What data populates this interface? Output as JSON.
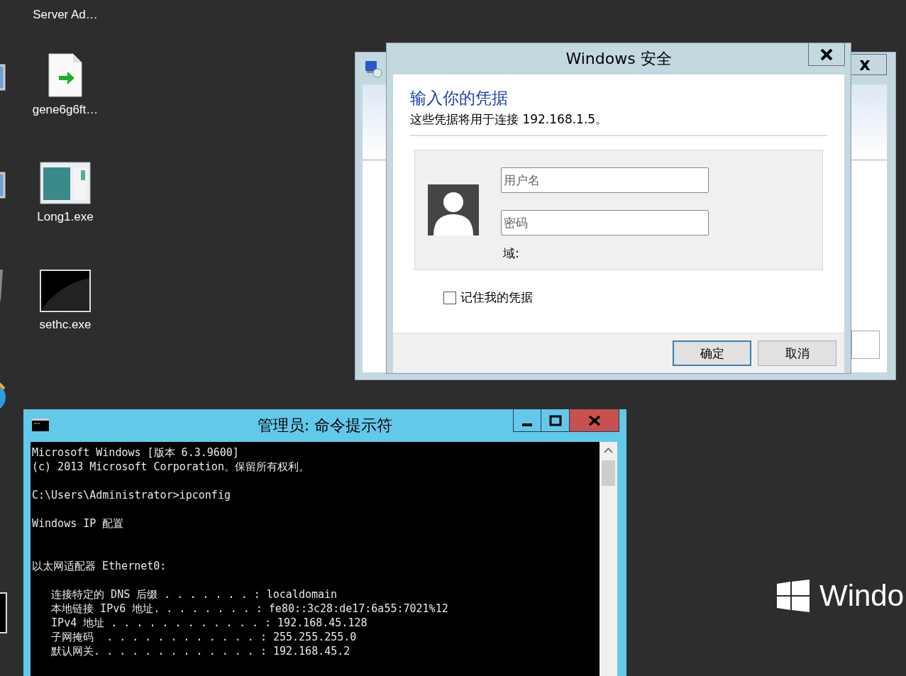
{
  "top_label": {
    "label": "Server Ad…"
  },
  "desktop_icons": [
    {
      "label": "gene6g6ft…",
      "kind": "document"
    },
    {
      "label": "Long1.exe",
      "kind": "app"
    },
    {
      "label": "sethc.exe",
      "kind": "console"
    }
  ],
  "background_window": {
    "close": "x"
  },
  "dialog": {
    "title": "Windows 安全",
    "heading": "输入你的凭据",
    "subtitle": "这些凭据将用于连接 192.168.1.5。",
    "username": {
      "placeholder": "用户名"
    },
    "password": {
      "placeholder": "密码"
    },
    "domain_label": "域:",
    "remember": {
      "label": "记住我的凭据",
      "checked": false
    },
    "buttons": [
      {
        "label": "确定",
        "selected": true
      },
      {
        "label": "取消",
        "selected": false
      }
    ]
  },
  "console": {
    "title": "管理员: 命令提示符",
    "lines": [
      {
        "text": "Microsoft Windows [版本 6.3.9600]",
        "kind": "plain"
      },
      {
        "text": "(c) 2013 Microsoft Corporation。保留所有权利。",
        "kind": "plain"
      },
      {
        "text": "C:\\Users\\Administrator>ipconfig",
        "kind": "after_blank"
      },
      {
        "text": "Windows IP 配置",
        "kind": "after_blank"
      },
      {
        "text": "以太网适配器 Ethernet0:",
        "kind": "after_two_blanks"
      },
      {
        "text": "   连接特定的 DNS 后缀 . . . . . . . : localdomain",
        "kind": "after_blank"
      },
      {
        "text": "   本地链接 IPv6 地址. . . . . . . . : fe80::3c28:de17:6a55:7021%12",
        "kind": "plain"
      },
      {
        "text": "   IPv4 地址 . . . . . . . . . . . . : 192.168.45.128",
        "kind": "plain"
      },
      {
        "text": "   子网掩码  . . . . . . . . . . . . : 255.255.255.0",
        "kind": "plain"
      },
      {
        "text": "   默认网关. . . . . . . . . . . . . : 192.168.45.2",
        "kind": "plain"
      }
    ]
  },
  "brand": {
    "text": "Windo"
  }
}
